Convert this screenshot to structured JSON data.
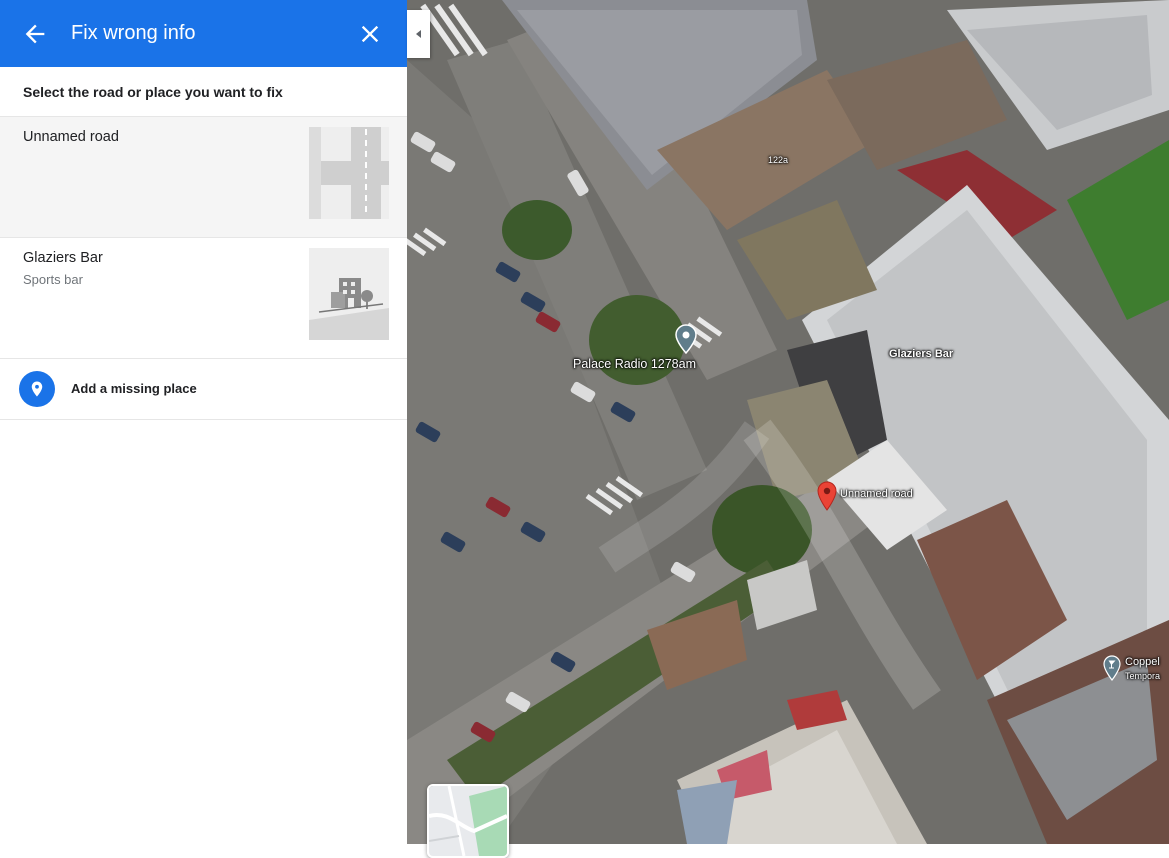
{
  "header": {
    "title": "Fix wrong info",
    "back_icon": "arrow-back-icon",
    "close_icon": "close-icon",
    "color": "#1a73e8"
  },
  "panel": {
    "heading": "Select the road or place you want to fix",
    "options": [
      {
        "title": "Unnamed road",
        "subtitle": "",
        "thumb_icon": "road-icon"
      },
      {
        "title": "Glaziers Bar",
        "subtitle": "Sports bar",
        "thumb_icon": "building-icon"
      }
    ],
    "add_missing": {
      "label": "Add a missing place",
      "icon": "location-pin-icon"
    }
  },
  "map": {
    "view": "satellite",
    "labels": {
      "palace_radio": "Palace Radio 1278am",
      "glaziers_bar": "Glaziers Bar",
      "unnamed_road": "Unnamed road",
      "address_122a": "122a",
      "coppell": "Coppel",
      "coppell_sub": "Tempora"
    },
    "pins": {
      "selected": "#ea4335",
      "place": "#607d8b"
    }
  }
}
